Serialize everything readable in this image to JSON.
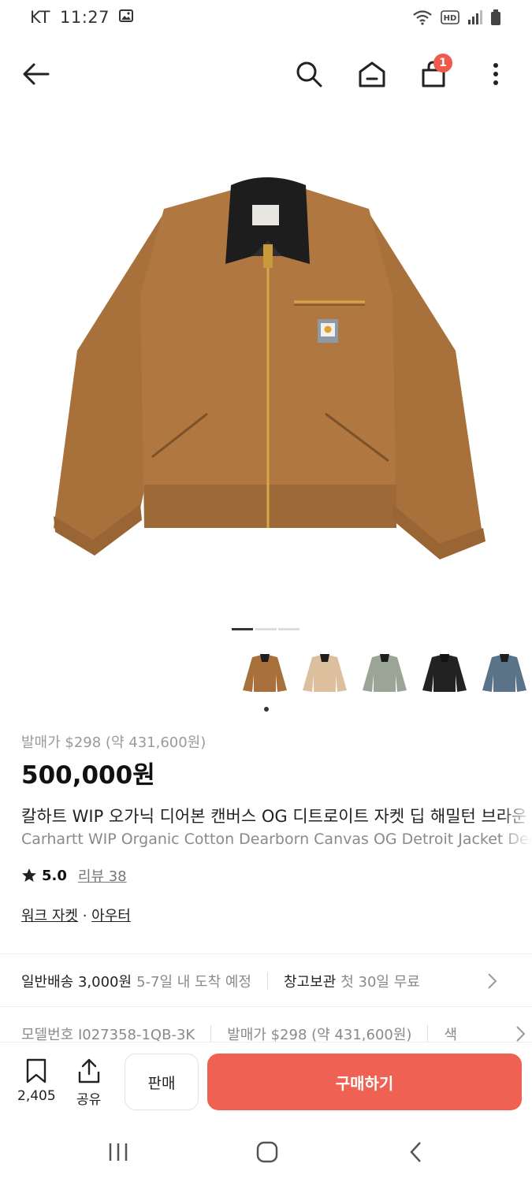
{
  "status_bar": {
    "carrier": "KT",
    "time": "11:27"
  },
  "top_nav": {
    "cart_count": "1"
  },
  "colors": {
    "accent": "#ef6253",
    "badge": "#ef5a4c",
    "jacket_brown": "#a8713c",
    "collar_black": "#1d1d1d"
  },
  "gallery": {
    "active_index": 0,
    "total": 3
  },
  "color_options": [
    {
      "name": "hamilton-brown",
      "color": "#a8713c"
    },
    {
      "name": "dusty-beige",
      "color": "#dcbf9c"
    },
    {
      "name": "sage-green",
      "color": "#9aa597"
    },
    {
      "name": "black",
      "color": "#222222"
    },
    {
      "name": "storm-blue",
      "color": "#5b7389"
    }
  ],
  "product": {
    "release_price": "발매가 $298 (약 431,600원)",
    "price": "500,000원",
    "title_ko": "칼하트 WIP 오가닉 디어본 캔버스 OG 디트로이트 자켓 딥 해밀턴 브라운",
    "title_en": "Carhartt WIP Organic Cotton Dearborn Canvas OG Detroit Jacket Deep Hamilton Brown",
    "rating": "5.0",
    "review_label": "리뷰 38",
    "category_1": "워크 자켓",
    "category_sep": " · ",
    "category_2": "아우터"
  },
  "shipping": {
    "normal_label": "일반배송 3,000원",
    "normal_eta": "5-7일 내 도착 예정",
    "storage_label": "창고보관",
    "storage_note": "첫 30일 무료"
  },
  "details": {
    "model": "모델번호 I027358-1QB-3K",
    "release": "발매가 $298 (약 431,600원)",
    "color_label": "색"
  },
  "bottom_bar": {
    "bookmark_count": "2,405",
    "share_label": "공유",
    "sell_label": "판매",
    "buy_label": "구매하기"
  }
}
